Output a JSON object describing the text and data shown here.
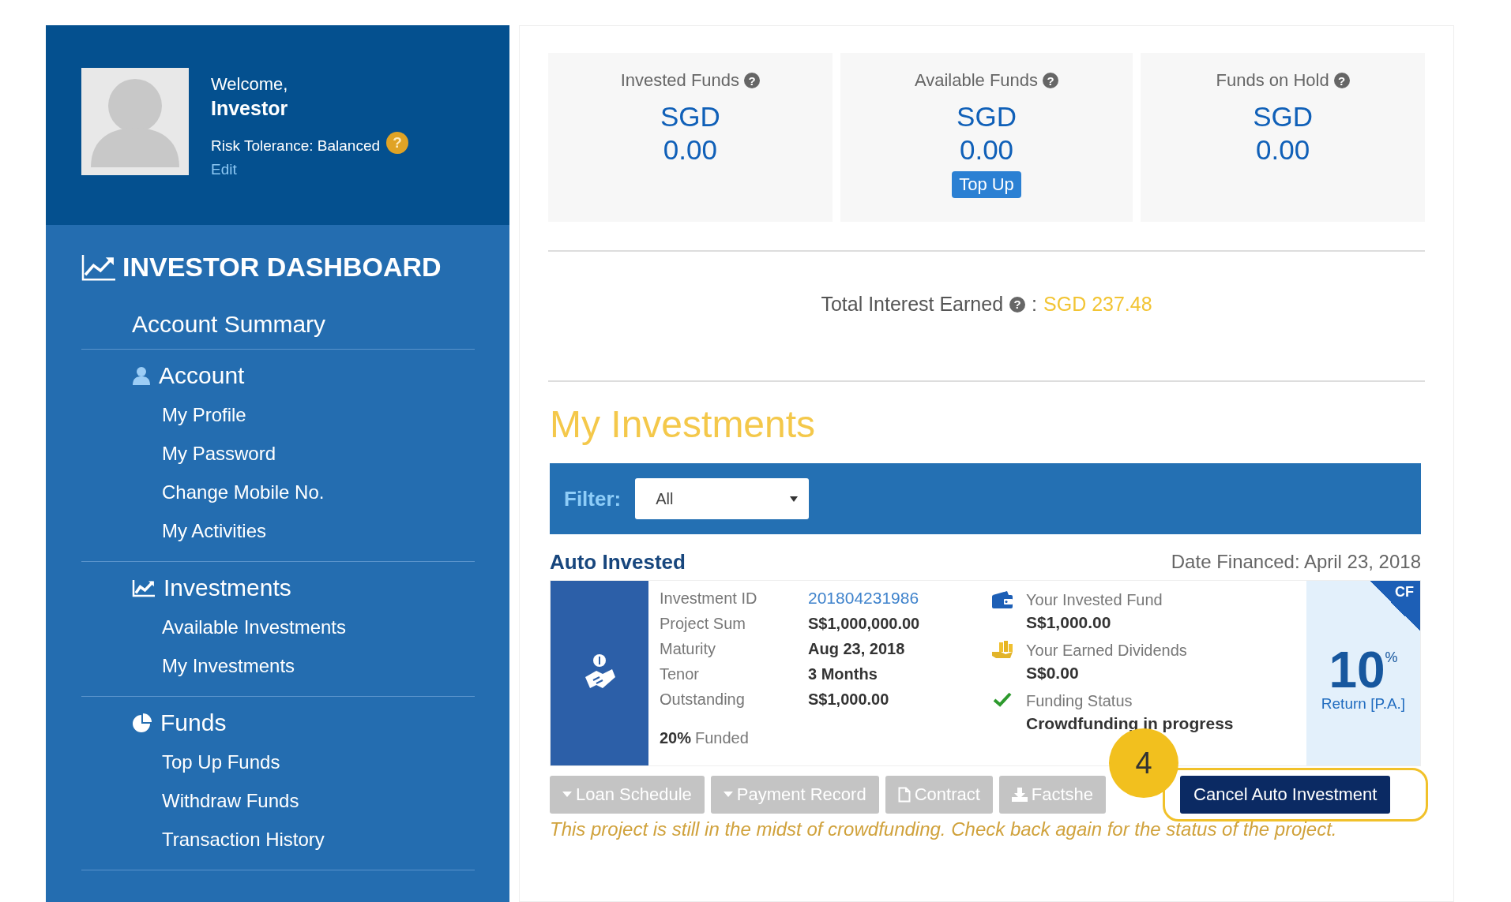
{
  "profile": {
    "greeting": "Welcome,",
    "name": "Investor",
    "risk": "Risk Tolerance: Balanced",
    "help": "?",
    "edit": "Edit"
  },
  "sidebar": {
    "title": "INVESTOR DASHBOARD",
    "items": [
      {
        "kind": "link",
        "label": "Account Summary"
      },
      {
        "kind": "section",
        "label": "Account",
        "children": [
          {
            "label": "My Profile"
          },
          {
            "label": "My Password"
          },
          {
            "label": "Change Mobile No."
          },
          {
            "label": "My Activities"
          }
        ]
      },
      {
        "kind": "section",
        "label": "Investments",
        "children": [
          {
            "label": "Available Investments"
          },
          {
            "label": "My Investments"
          }
        ]
      },
      {
        "kind": "section",
        "label": "Funds",
        "children": [
          {
            "label": "Top Up Funds"
          },
          {
            "label": "Withdraw Funds"
          },
          {
            "label": "Transaction History"
          }
        ]
      }
    ]
  },
  "summary": [
    {
      "label": "Invested Funds",
      "help": "?",
      "currency": "SGD",
      "amount": "0.00"
    },
    {
      "label": "Available Funds",
      "help": "?",
      "currency": "SGD",
      "amount": "0.00",
      "action": "Top Up"
    },
    {
      "label": "Funds on Hold",
      "help": "?",
      "currency": "SGD",
      "amount": "0.00"
    }
  ],
  "interest": {
    "label": "Total Interest Earned",
    "help": "?",
    "separator": ":",
    "value": "SGD 237.48"
  },
  "investments": {
    "title": "My Investments",
    "filter": {
      "label": "Filter:",
      "value": "All"
    },
    "items": [
      {
        "type_label": "Auto Invested",
        "date": "Date Financed: April 23, 2018",
        "details": [
          {
            "label": "Investment ID",
            "value": "201804231986",
            "link": true
          },
          {
            "label": "Project Sum",
            "value": "S$1,000,000.00",
            "link": false
          },
          {
            "label": "Maturity",
            "value": "Aug 23, 2018",
            "link": false
          },
          {
            "label": "Tenor",
            "value": "3 Months",
            "link": false
          },
          {
            "label": "Outstanding",
            "value": "S$1,000.00",
            "link": false
          }
        ],
        "funded": "20%",
        "funded_label": "Funded",
        "stats": [
          {
            "kind": "wallet",
            "label": "Your Invested Fund",
            "value": "S$1,000.00"
          },
          {
            "kind": "coins",
            "label": "Your Earned Dividends",
            "value": "S$0.00"
          },
          {
            "kind": "check",
            "label": "Funding Status",
            "value": "Crowdfunding in progress"
          }
        ],
        "corner": "CF",
        "rate": "10",
        "rate_unit": "%",
        "rate_label": "Return [P.A.]",
        "buttons": [
          {
            "kind": "dropdown",
            "label": "Loan Schedule"
          },
          {
            "kind": "dropdown",
            "label": "Payment Record"
          },
          {
            "kind": "document",
            "label": "Contract"
          },
          {
            "kind": "download",
            "label": "Factshe"
          },
          {
            "kind": "primary",
            "label": "Cancel Auto Investment"
          }
        ],
        "note": "This project is still in the midst of crowdfunding. Check back again for the status of the project."
      }
    ]
  },
  "callout": {
    "number": "4"
  }
}
